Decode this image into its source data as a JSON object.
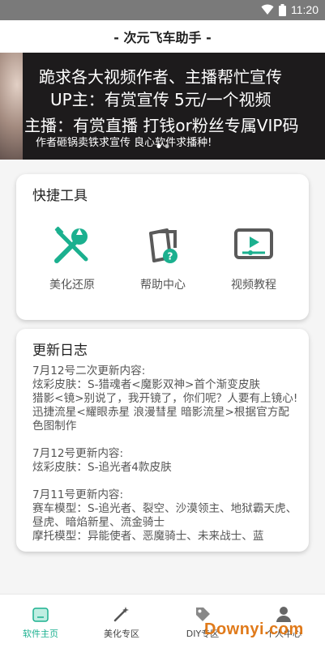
{
  "status": {
    "time": "11:20"
  },
  "app": {
    "title": "- 次元飞车助手 -"
  },
  "banner": {
    "line1": "跪求各大视频作者、主播帮忙宣传",
    "line2": "UP主：有赏宣传  5元/一个视频",
    "line3": "主播：有赏直播 打钱or粉丝专属VIP码",
    "line4": "作者砸锅卖铁求宣传 良心软件求播种!"
  },
  "tools": {
    "title": "快捷工具",
    "items": [
      {
        "label": "美化还原",
        "icon": "wrench-screwdriver-icon"
      },
      {
        "label": "帮助中心",
        "icon": "help-document-icon"
      },
      {
        "label": "视频教程",
        "icon": "video-play-icon"
      }
    ]
  },
  "log": {
    "title": "更新日志",
    "paragraphs": [
      "7月12号二次更新内容:\n炫彩皮肤：S-猎魂者<魔影双神>首个渐变皮肤\n猎影<镜>别说了，我开镜了，你们呢？人要有上镜心!\n迅捷流星<耀眼赤星 浪漫彗星 暗影流星>根据官方配色图制作",
      "7月12号更新内容:\n炫彩皮肤：S-追光者4款皮肤",
      "7月11号更新内容:\n赛车模型：S-追光者、裂空、沙漠领主、地狱霸天虎、昼虎、暗焰新星、流金骑士\n摩托模型：异能使者、恶魔骑士、未来战士、蓝"
    ]
  },
  "nav": {
    "items": [
      {
        "label": "软件主页",
        "icon": "home-icon"
      },
      {
        "label": "美化专区",
        "icon": "magic-wand-icon"
      },
      {
        "label": "DIY专区",
        "icon": "diy-tag-icon"
      },
      {
        "label": "个人中心",
        "icon": "person-icon"
      }
    ]
  },
  "watermark": {
    "text": "Downyi.com"
  },
  "colors": {
    "accent": "#1bb08f",
    "icon_gray": "#5a5a5a"
  }
}
